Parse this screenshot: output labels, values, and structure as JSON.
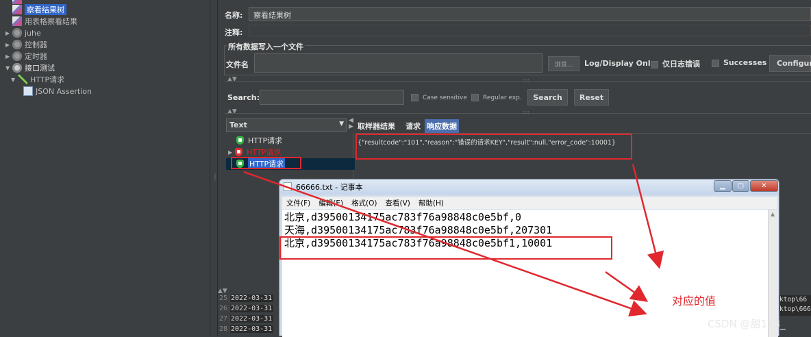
{
  "tree": {
    "items": [
      {
        "label": "察看结果树",
        "selected": true,
        "icon": "chart-icon"
      },
      {
        "label": "用表格察看结果",
        "icon": "chart-icon"
      },
      {
        "label": "juhe",
        "icon": "gear-icon"
      },
      {
        "label": "控制器",
        "icon": "gear-icon"
      },
      {
        "label": "定时器",
        "icon": "gear-icon"
      },
      {
        "label": "接口测试",
        "icon": "gear-icon"
      },
      {
        "label": "HTTP请求",
        "icon": "pen-icon"
      },
      {
        "label": "JSON Assertion",
        "icon": "json-icon"
      }
    ]
  },
  "main": {
    "name_label": "名称:",
    "name_value": "察看结果树",
    "comment_label": "注释:",
    "section_title": "所有数据写入一个文件",
    "file_label": "文件名",
    "browse_label": "浏览...",
    "log_display_label": "Log/Display Only:",
    "errors_only_label": "仅日志错误",
    "successes_label": "Successes",
    "configure_label": "Configure",
    "search_label": "Search:",
    "case_sensitive_label": "Case sensitive",
    "regular_exp_label": "Regular exp.",
    "search_button": "Search",
    "reset_button": "Reset",
    "renderer_select": "Text",
    "tabs": [
      "取样器结果",
      "请求",
      "响应数据"
    ],
    "response_text": "{\"resultcode\":\"101\",\"reason\":\"错误的请求KEY\",\"result\":null,\"error_code\":10001}",
    "results": [
      {
        "label": "HTTP请求",
        "status": "ok"
      },
      {
        "label": "HTTP请求",
        "status": "error"
      },
      {
        "label": "HTTP请求",
        "status": "ok"
      }
    ],
    "log_rows": [
      {
        "num": "25",
        "text": "2022-03-31"
      },
      {
        "num": "26",
        "text": "2022-03-31"
      },
      {
        "num": "27",
        "text": "2022-03-31"
      },
      {
        "num": "28",
        "text": "2022-03-31"
      }
    ],
    "log_right": [
      "ktop\\66",
      "ktop\\666"
    ]
  },
  "notepad": {
    "title": "66666.txt - 记事本",
    "menu": [
      "文件(F)",
      "编辑(E)",
      "格式(O)",
      "查看(V)",
      "帮助(H)"
    ],
    "lines": [
      "北京,d39500134175ac783f76a98848c0e5bf,0",
      "天海,d39500134175ac783f76a98848c0e5bf,207301",
      "北京,d39500134175ac783f76a98848c0e5bf1,10001"
    ]
  },
  "annotation": "对应的值",
  "watermark": "CSDN @甜123_",
  "colors": {
    "accent": "#2f65ca",
    "annotation": "#e0282e"
  }
}
